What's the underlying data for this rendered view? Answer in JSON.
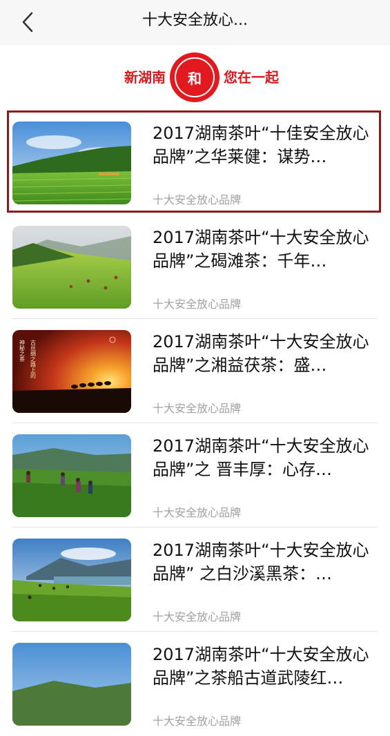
{
  "nav": {
    "title": "十大安全放心...",
    "back_icon": "chevron-left-icon"
  },
  "banner": {
    "left_text": "新湖南",
    "logo_text": "和",
    "right_text": "您在一起",
    "brand_color": "#e21a1f"
  },
  "articles": [
    {
      "title": "2017湖南茶叶“十佳安全放心品牌”之华莱健：谋势…",
      "source": "十大安全放心品牌",
      "selected": true,
      "thumb": "tea-hill-field-image"
    },
    {
      "title": "2017湖南茶叶“十大安全放心品牌”之碣滩茶：千年…",
      "source": "十大安全放心品牌",
      "selected": false,
      "thumb": "tea-pickers-hillside-image"
    },
    {
      "title": "2017湖南茶叶“十大安全放心品牌”之湘益茯茶：盛…",
      "source": "十大安全放心品牌",
      "selected": false,
      "thumb": "camel-caravan-sunset-image",
      "thumb_text_vertical_1": "神秘之茶",
      "thumb_text_vertical_2": "古丝绸之路上的"
    },
    {
      "title": "2017湖南茶叶“十大安全放心品牌”之 晋丰厚：心存…",
      "source": "十大安全放心品牌",
      "selected": false,
      "thumb": "tea-pickers-mountain-image"
    },
    {
      "title": "2017湖南茶叶“十大安全放心品牌” 之白沙溪黑茶：…",
      "source": "十大安全放心品牌",
      "selected": false,
      "thumb": "tea-garden-lake-image"
    },
    {
      "title": "2017湖南茶叶“十大安全放心品牌”之茶船古道武陵红…",
      "source": "十大安全放心品牌",
      "selected": false,
      "thumb": "sky-landscape-image"
    }
  ]
}
